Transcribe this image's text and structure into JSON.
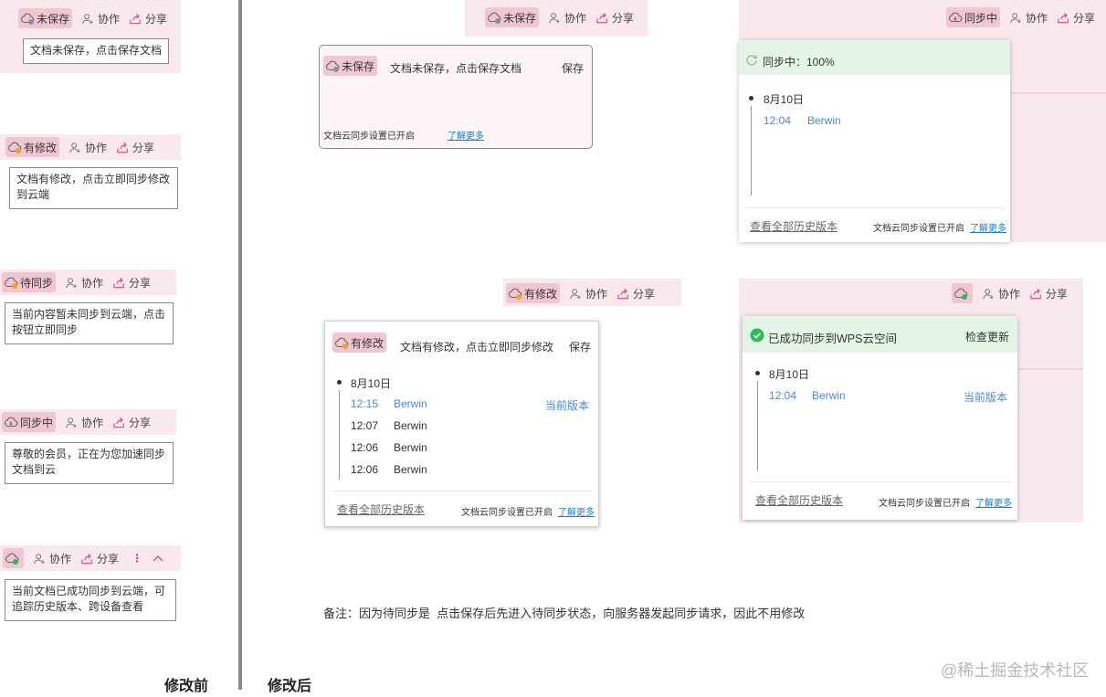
{
  "labels": {
    "unsaved": "未保存",
    "modified": "有修改",
    "pending": "待同步",
    "syncing": "同步中",
    "collab": "协作",
    "share": "分享"
  },
  "before": {
    "title": "修改前",
    "tips": {
      "unsaved": "文档未保存，点击保存文档",
      "modified": "文档有修改，点击立即同步修改到云端",
      "pending": "当前内容暂未同步到云端，点击按钮立即同步",
      "syncing": "尊敬的会员，正在为您加速同步文档到云",
      "synced": "当前文档已成功同步到云端，可追踪历史版本、跨设备查看"
    }
  },
  "after": {
    "title": "修改后",
    "unsaved_panel": {
      "text": "文档未保存，点击保存文档",
      "save": "保存",
      "cloud_setting": "文档云同步设置已开启",
      "learn_more": "了解更多"
    },
    "syncing_panel": {
      "progress": "同步中：100%",
      "date": "8月10日",
      "entries": [
        {
          "time": "12:04",
          "user": "Berwin"
        }
      ],
      "history": "查看全部历史版本",
      "cloud_setting": "文档云同步设置已开启",
      "learn_more": "了解更多"
    },
    "modified_panel": {
      "text": "文档有修改，点击立即同步修改",
      "save": "保存",
      "date": "8月10日",
      "entries": [
        {
          "time": "12:15",
          "user": "Berwin",
          "current": "当前版本"
        },
        {
          "time": "12:07",
          "user": "Berwin"
        },
        {
          "time": "12:06",
          "user": "Berwin"
        },
        {
          "time": "12:06",
          "user": "Berwin"
        }
      ],
      "history": "查看全部历史版本",
      "cloud_setting": "文档云同步设置已开启",
      "learn_more": "了解更多"
    },
    "synced_panel": {
      "message": "已成功同步到WPS云空间",
      "check_update": "检查更新",
      "date": "8月10日",
      "entries": [
        {
          "time": "12:04",
          "user": "Berwin",
          "current": "当前版本"
        }
      ],
      "history": "查看全部历史版本",
      "cloud_setting": "文档云同步设置已开启",
      "learn_more": "了解更多"
    },
    "note": "备注：因为待同步是  点击保存后先进入待同步状态，向服务器发起同步请求，因此不用修改"
  },
  "watermark": "@稀土掘金技术社区",
  "colors": {
    "accent": "#e0457b",
    "link": "#1a7fd4",
    "blue": "#4a89dc",
    "green": "#2dba5a",
    "pink_bg": "#f9e8ec"
  }
}
